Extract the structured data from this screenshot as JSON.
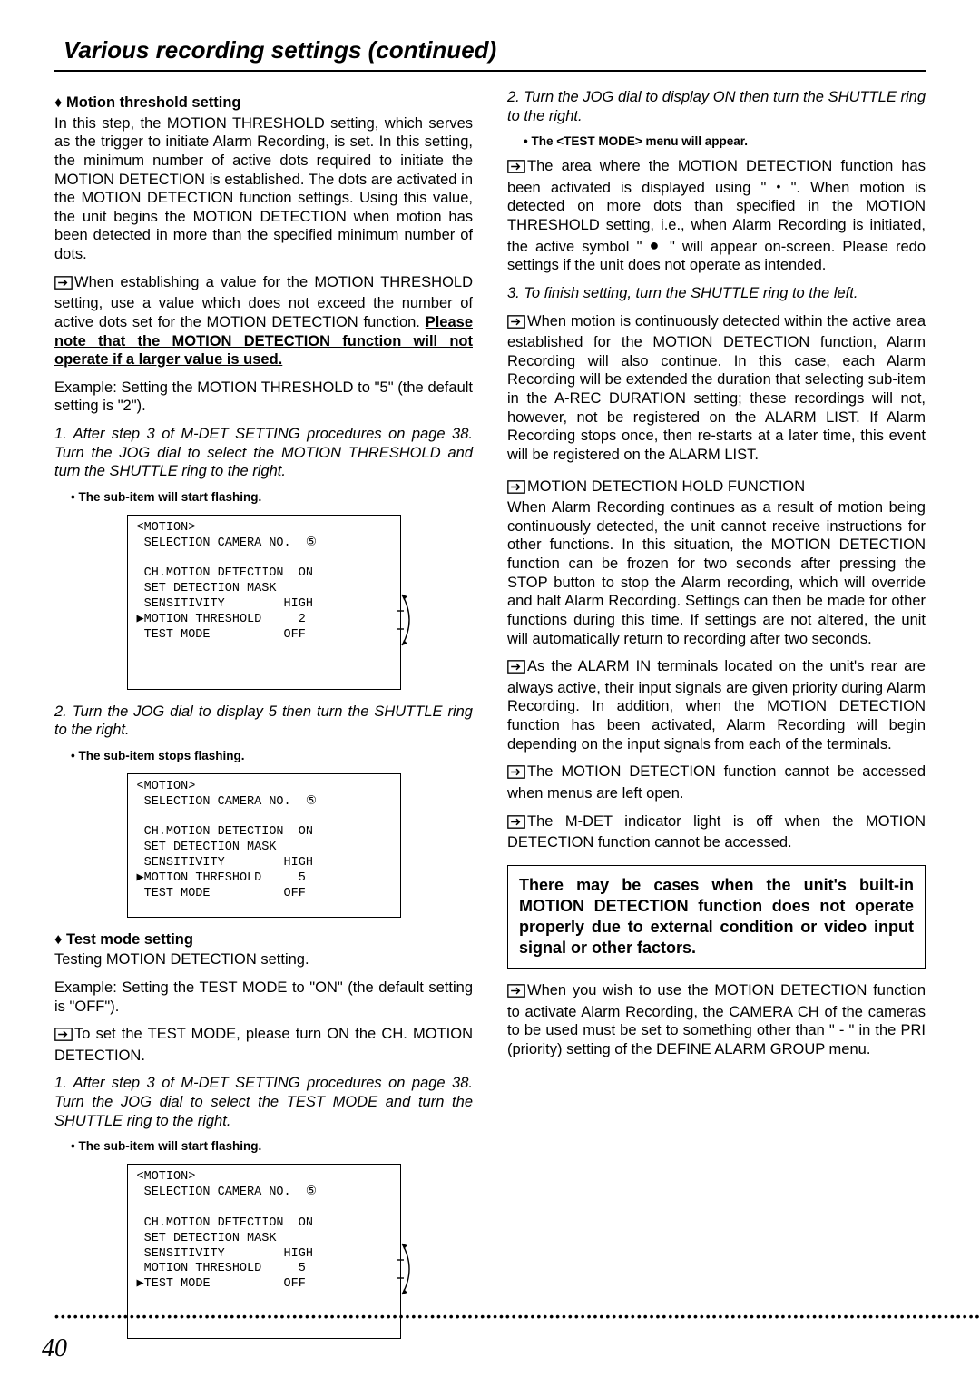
{
  "pageTitle": "Various recording settings (continued)",
  "pageNumber": "40",
  "left": {
    "h1": "♦ Motion threshold setting",
    "p1": "In this step, the MOTION THRESHOLD setting, which serves as the trigger to initiate Alarm Recording, is set. In this setting, the minimum number of active dots required to initiate the MOTION DETECTION is established. The dots are activated in the MOTION DETECTION function settings. Using this value, the unit begins the MOTION DETECTION when motion has been detected in more than the specified minimum number of dots.",
    "note1a": "When establishing a value for the MOTION THRESHOLD setting, use a value which does not exceed the number of active dots set for the MOTION DETECTION function. ",
    "note1b_under": "Please note that the MOTION DETECTION function will not operate if a larger value is used.",
    "p2": "Example: Setting the MOTION THRESHOLD to \"5\" (the default setting is \"2\").",
    "step1": "1. After step 3 of M-DET SETTING procedures on page 38. Turn the JOG dial to select the MOTION THRESHOLD and turn the SHUTTLE ring to the right.",
    "step1note": "• The sub-item will start flashing.",
    "menu1": "<MOTION>\n SELECTION CAMERA NO.  ⑤\n\n CH.MOTION DETECTION  ON\n SET DETECTION MASK\n SENSITIVITY        HIGH\n▶MOTION THRESHOLD     2\n TEST MODE          OFF",
    "step2": "2. Turn the JOG dial to display 5 then turn the SHUTTLE ring to the right.",
    "step2note": "• The sub-item stops flashing.",
    "menu2": "<MOTION>\n SELECTION CAMERA NO.  ⑤\n\n CH.MOTION DETECTION  ON\n SET DETECTION MASK\n SENSITIVITY        HIGH\n▶MOTION THRESHOLD     5\n TEST MODE          OFF",
    "h2": "♦ Test mode setting",
    "p3": "Testing MOTION DETECTION setting.",
    "p4": "Example: Setting the TEST MODE to \"ON\" (the default setting is \"OFF\").",
    "note2": "To set the TEST MODE, please turn ON the CH. MOTION DETECTION.",
    "step3": "1. After step 3 of M-DET SETTING procedures on page 38. Turn the JOG dial to select the TEST MODE and turn the SHUTTLE ring to the right.",
    "step3note": "• The sub-item will start flashing.",
    "menu3": "<MOTION>\n SELECTION CAMERA NO.  ⑤\n\n CH.MOTION DETECTION  ON\n SET DETECTION MASK\n SENSITIVITY        HIGH\n MOTION THRESHOLD     5\n▶TEST MODE          OFF"
  },
  "right": {
    "step2": "2. Turn the JOG dial to display ON then turn the SHUTTLE ring to the right.",
    "step2note": "• The <TEST MODE> menu will appear.",
    "para1a": "The area where the MOTION DETECTION function has been activated is displayed using \" ",
    "para1b": " \". When motion is detected on more dots than specified in the MOTION THRESHOLD setting, i.e., when Alarm Recording is initiated, the active symbol \" ",
    "para1c": " \" will appear on-screen. Please redo settings if the unit does not operate as intended.",
    "step3": "3. To finish setting, turn the SHUTTLE ring to the left.",
    "para2": "When motion is continuously detected within the active area established for the MOTION DETECTION function, Alarm Recording will also continue. In this case, each Alarm Recording will be extended the duration that selecting sub-item in the A-REC DURATION setting; these recordings will not, however, not be registered on the ALARM LIST.  If Alarm Recording stops once, then re-starts at a later time, this event will be registered on the ALARM LIST.",
    "para3head": "MOTION DETECTION HOLD FUNCTION",
    "para3": "When Alarm Recording continues as a result of motion being continuously detected, the unit cannot receive instructions for other functions. In this situation, the MOTION DETECTION function can be frozen for two seconds after pressing the STOP button to stop the Alarm recording, which will override and halt Alarm Recording. Settings can then be made for other functions during this time. If settings are not altered, the unit will automatically return to recording after two seconds.",
    "para4": "As the ALARM IN terminals located on the unit's rear are always active, their input signals are given priority during Alarm Recording. In addition, when the MOTION DETECTION function has been activated, Alarm Recording will begin depending on the input signals from each of the terminals.",
    "para5": "The MOTION DETECTION function cannot be accessed when menus are left open.",
    "para6": "The M-DET indicator light is off when the MOTION DETECTION function cannot be accessed.",
    "notice": "There may be cases when the unit's built-in MOTION DETECTION function does not operate properly due to external condition or video input signal or other factors.",
    "para7": "When you wish to use the MOTION DETECTION function to activate Alarm Recording, the CAMERA CH of the cameras to be used must be set to something other than \" - \" in the PRI (priority) setting of the DEFINE ALARM GROUP menu."
  }
}
